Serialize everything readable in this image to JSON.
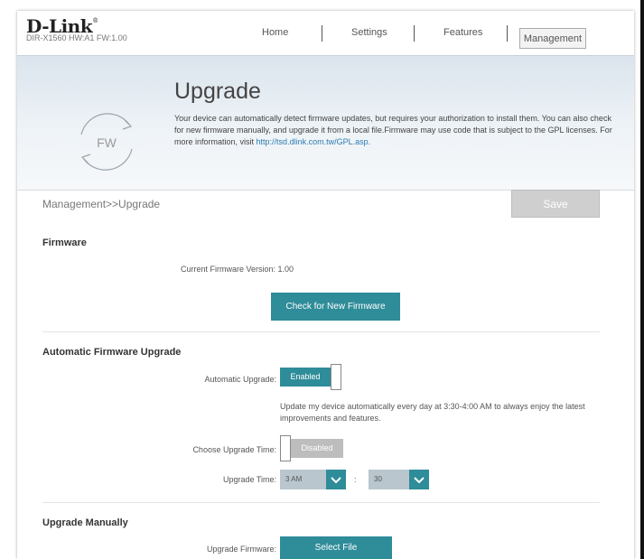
{
  "header": {
    "logo": "D-Link",
    "logo_mark": "®",
    "model": "DIR-X1560 HW:A1 FW:1.00",
    "nav": {
      "home": "Home",
      "settings": "Settings",
      "features": "Features",
      "management": "Management"
    }
  },
  "banner": {
    "icon_label": "FW",
    "title": "Upgrade",
    "description": "Your device can automatically detect firmware updates, but requires your authorization to install them. You can also check for new firmware manually, and upgrade it from a local file.Firmware may use code that is subject to the GPL licenses. For more information, visit",
    "link": "http://tsd.dlink.com.tw/GPL.asp."
  },
  "breadcrumb": "Management>>Upgrade",
  "save_label": "Save",
  "firmware": {
    "title": "Firmware",
    "current_label": "Current Firmware Version:",
    "current_value": "1.00",
    "check_button": "Check for New Firmware"
  },
  "auto_upgrade": {
    "title": "Automatic Firmware Upgrade",
    "toggle_label": "Automatic Upgrade:",
    "toggle_state": "Enabled",
    "info": "Update my device automatically every day at 3:30-4:00 AM to always enjoy the latest improvements and features.",
    "choose_time_label": "Choose Upgrade Time:",
    "choose_time_state": "Disabled",
    "time_label": "Upgrade Time:",
    "hour_value": "3 AM",
    "separator": ":",
    "minute_value": "30"
  },
  "manual": {
    "title": "Upgrade Manually",
    "label": "Upgrade Firmware:",
    "button": "Select File"
  },
  "colors": {
    "accent": "#2f8c99",
    "disabled_toggle": "#bdbdbd",
    "save_disabled": "#cfcfcf",
    "link": "#2b7bb0"
  },
  "icons": [
    "refresh-arrows-icon",
    "chevron-down-icon"
  ]
}
